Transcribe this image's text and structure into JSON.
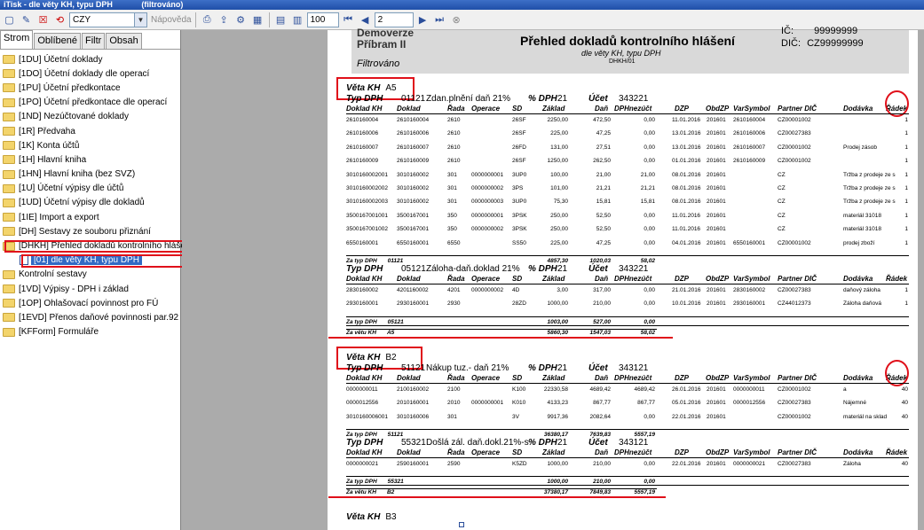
{
  "window": {
    "title": "iTisk - dle věty KH, typu DPH",
    "status": "(filtrováno)"
  },
  "toolbar": {
    "filter_value": "CZY",
    "help_label": "Nápověda",
    "zoom": "100",
    "page": "2",
    "icons": [
      "new-icon",
      "edit-icon",
      "delete-icon",
      "refresh-icon",
      "print-icon",
      "export-icon",
      "settings-icon",
      "view-icon",
      "first-page-icon",
      "prev-page-icon",
      "next-page-icon",
      "last-page-icon",
      "stop-icon"
    ]
  },
  "sidebar": {
    "tabs": [
      {
        "label": "Strom",
        "active": true
      },
      {
        "label": "Oblíbené",
        "active": false
      },
      {
        "label": "Filtr",
        "active": false
      },
      {
        "label": "Obsah",
        "active": false
      }
    ],
    "items": [
      {
        "label": "[1DU] Účetní doklady"
      },
      {
        "label": "[1DO] Účetní doklady dle operací"
      },
      {
        "label": "[1PU] Účetní předkontace"
      },
      {
        "label": "[1PO] Účetní předkontace dle operací"
      },
      {
        "label": "[1ND] Nezúčtované doklady"
      },
      {
        "label": "[1R] Předvaha"
      },
      {
        "label": "[1K] Konta účtů"
      },
      {
        "label": "[1H] Hlavní kniha"
      },
      {
        "label": "[1HN] Hlavní kniha (bez SVZ)"
      },
      {
        "label": "[1U] Účetní výpisy dle účtů"
      },
      {
        "label": "[1UD] Účetní výpisy dle dokladů"
      },
      {
        "label": "[1IE] Import a export"
      },
      {
        "label": "[DH] Sestavy ze souboru přiznání"
      },
      {
        "label": "[DHKH] Přehled dokladů kontrolního hlášení"
      },
      {
        "label": "[01] dle věty KH, typu DPH",
        "child": true,
        "selected": true
      },
      {
        "label": "Kontrolní sestavy"
      },
      {
        "label": "[1VD] Výpisy - DPH i základ"
      },
      {
        "label": "[1OP] Ohlašovací povinnost pro FÚ"
      },
      {
        "label": "[1EVD] Přenos daňové povinnosti par.92"
      },
      {
        "label": "[KFForm] Formuláře"
      }
    ]
  },
  "report": {
    "company1": "Demoverze",
    "company2": "Příbram II",
    "title": "Přehled dokladů kontrolního hlášení",
    "subtitle": "dle věty KH, typu DPH",
    "code": "DHKH/01",
    "filter": "Filtrováno",
    "ic_label": "IČ:",
    "ic_value": "99999999",
    "dic_label": "DIČ:",
    "dic_value": "CZ99999999",
    "labels": {
      "veta": "Věta KH",
      "typ": "Typ DPH",
      "pct": "% DPH",
      "ucet": "Účet",
      "za_typ": "Za typ DPH",
      "za_vetu": "Za větu KH"
    },
    "columns": [
      "Doklad KH",
      "Doklad",
      "Řada",
      "Operace",
      "SD",
      "Základ",
      "Daň",
      "DPHnezúčt",
      "DZP",
      "ObdZP",
      "VarSymbol",
      "Partner DIČ",
      "Dodávka",
      "Řádek"
    ],
    "sections": [
      {
        "veta": "A5",
        "groups": [
          {
            "typ": "01121",
            "desc": "Zdan.plnění daň 21%",
            "pct": "21",
            "ucet": "343221",
            "rows": [
              [
                "2610160004",
                "2610160004",
                "2610",
                "",
                "26SF",
                "2250,00",
                "472,50",
                "0,00",
                "11.01.2016",
                "201601",
                "2610160004",
                "CZ00001002",
                "",
                "1"
              ],
              [
                "2610160006",
                "2610160006",
                "2610",
                "",
                "26SF",
                "225,00",
                "47,25",
                "0,00",
                "13.01.2016",
                "201601",
                "2610160006",
                "CZ00027383",
                "",
                "1"
              ],
              [
                "2610160007",
                "2610160007",
                "2610",
                "",
                "26FD",
                "131,00",
                "27,51",
                "0,00",
                "13.01.2016",
                "201601",
                "2610160007",
                "CZ00001002",
                "Prodej zásob",
                "1"
              ],
              [
                "2610160009",
                "2610160009",
                "2610",
                "",
                "26SF",
                "1250,00",
                "262,50",
                "0,00",
                "01.01.2016",
                "201601",
                "2610160009",
                "CZ00001002",
                "",
                "1"
              ],
              [
                "3010160002001",
                "3010160002",
                "301",
                "0000000001",
                "3UP0",
                "100,00",
                "21,00",
                "21,00",
                "08.01.2016",
                "201601",
                "",
                "CZ",
                "Tržba z prodeje ze s",
                "1"
              ],
              [
                "3010160002002",
                "3010160002",
                "301",
                "0000000002",
                "3PS",
                "101,00",
                "21,21",
                "21,21",
                "08.01.2016",
                "201601",
                "",
                "CZ",
                "Tržba z prodeje ze s",
                "1"
              ],
              [
                "3010160002003",
                "3010160002",
                "301",
                "0000000003",
                "3UP0",
                "75,30",
                "15,81",
                "15,81",
                "08.01.2016",
                "201601",
                "",
                "CZ",
                "Tržba z prodeje ze s",
                "1"
              ],
              [
                "3500167001001",
                "3500167001",
                "350",
                "0000000001",
                "3PSK",
                "250,00",
                "52,50",
                "0,00",
                "11.01.2016",
                "201601",
                "",
                "CZ",
                "materiál 31018",
                "1"
              ],
              [
                "3500167001002",
                "3500167001",
                "350",
                "0000000002",
                "3PSK",
                "250,00",
                "52,50",
                "0,00",
                "11.01.2016",
                "201601",
                "",
                "CZ",
                "materiál 31018",
                "1"
              ],
              [
                "6550160001",
                "6550160001",
                "6550",
                "",
                "SS50",
                "225,00",
                "47,25",
                "0,00",
                "04.01.2016",
                "201601",
                "6550160001",
                "CZ00001002",
                "prodej zboží",
                "1"
              ]
            ],
            "sum": {
              "typ": "01121",
              "zaklad": "4857,30",
              "dan": "1020,03",
              "nez": "58,02"
            }
          },
          {
            "typ": "05121",
            "desc": "Záloha-daň.doklad 21%",
            "pct": "21",
            "ucet": "343221",
            "rows": [
              [
                "2830160002",
                "4201160002",
                "4201",
                "0000000002",
                "4D",
                "3,00",
                "317,00",
                "0,00",
                "21.01.2016",
                "201601",
                "2830160002",
                "CZ00027383",
                "daňový záloha",
                "1"
              ],
              [
                "2930160001",
                "2930160001",
                "2930",
                "",
                "28ZD",
                "1000,00",
                "210,00",
                "0,00",
                "10.01.2016",
                "201601",
                "2930160001",
                "CZ44012373",
                "Záloha daňová",
                "1"
              ]
            ],
            "sum": {
              "typ": "05121",
              "zaklad": "1003,00",
              "dan": "527,00",
              "nez": "0,00"
            }
          }
        ],
        "total": {
          "veta": "A5",
          "zaklad": "5860,30",
          "dan": "1547,03",
          "nez": "58,02"
        }
      },
      {
        "veta": "B2",
        "groups": [
          {
            "typ": "51121",
            "desc": "Nákup tuz.- daň 21%",
            "pct": "21",
            "ucet": "343121",
            "rows": [
              [
                "0000000011",
                "2100160002",
                "2100",
                "",
                "K100",
                "22330,58",
                "4689,42",
                "4689,42",
                "26.01.2016",
                "201601",
                "0000000011",
                "CZ00001002",
                "a",
                "40"
              ],
              [
                "0000012556",
                "2010160001",
                "2010",
                "0000000001",
                "K010",
                "4133,23",
                "867,77",
                "867,77",
                "05.01.2016",
                "201601",
                "0000012556",
                "CZ00027383",
                "Nájemné",
                "40"
              ],
              [
                "3010160006001",
                "3010160006",
                "301",
                "",
                "3V",
                "9917,36",
                "2082,64",
                "0,00",
                "22.01.2016",
                "201601",
                "",
                "CZ00001002",
                "materiál na sklad",
                "40"
              ]
            ],
            "sum": {
              "typ": "51121",
              "zaklad": "36380,17",
              "dan": "7639,83",
              "nez": "5557,19"
            }
          },
          {
            "typ": "55321",
            "desc": "Došlá zál. daň.dokl.21%-s",
            "pct": "21",
            "ucet": "343121",
            "rows": [
              [
                "0000000021",
                "2590160001",
                "2590",
                "",
                "K5ZD",
                "1000,00",
                "210,00",
                "0,00",
                "22.01.2016",
                "201601",
                "0000000021",
                "CZ00027383",
                "Záloha",
                "40"
              ]
            ],
            "sum": {
              "typ": "55321",
              "zaklad": "1000,00",
              "dan": "210,00",
              "nez": "0,00"
            }
          }
        ],
        "total": {
          "veta": "B2",
          "zaklad": "37380,17",
          "dan": "7849,83",
          "nez": "5557,19"
        }
      },
      {
        "veta": "B3",
        "groups": []
      }
    ]
  }
}
